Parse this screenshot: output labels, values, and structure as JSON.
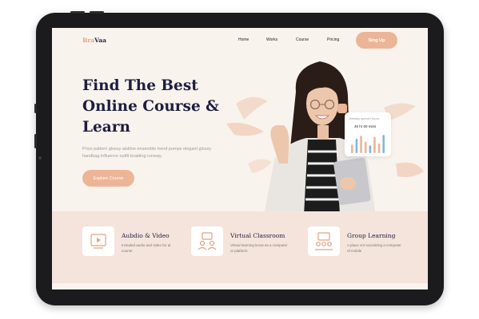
{
  "brand": {
    "part1": "Bra",
    "part2": "Vaa"
  },
  "nav": {
    "links": [
      "Home",
      "Works",
      "Course",
      "Pricing"
    ],
    "signup": "Sing Up"
  },
  "hero": {
    "title_lines": [
      "Find The Best",
      "Online Course &",
      "Learn"
    ],
    "description": "Price pattern glossy aistline ensemble trend pumps elegant glossy handbag influence outfit braiding runway.",
    "cta": "Explore Course"
  },
  "stats_card": {
    "title": "Weekly spend Hours",
    "value": "45 hr 60 mins",
    "bar_levels": [
      0.45,
      0.75,
      0.9,
      0.6,
      0.4,
      0.85,
      0.5,
      0.95
    ]
  },
  "features": [
    {
      "title": "Aubdio & Video",
      "desc": "Included audio and video for al course",
      "icon": "video-player-icon"
    },
    {
      "title": "Virtual Classroom",
      "desc": "Virtual learning know as a computer or platform",
      "icon": "classroom-icon"
    },
    {
      "title": "Group Learning",
      "desc": "A place vot socializing a computer of mobile",
      "icon": "group-learning-icon"
    }
  ],
  "colors": {
    "accent": "#ecb597",
    "navy": "#1c1e3f",
    "bg": "#f9f3ee",
    "band": "#f5e4dc",
    "bar_blue": "#7fb7d9"
  }
}
